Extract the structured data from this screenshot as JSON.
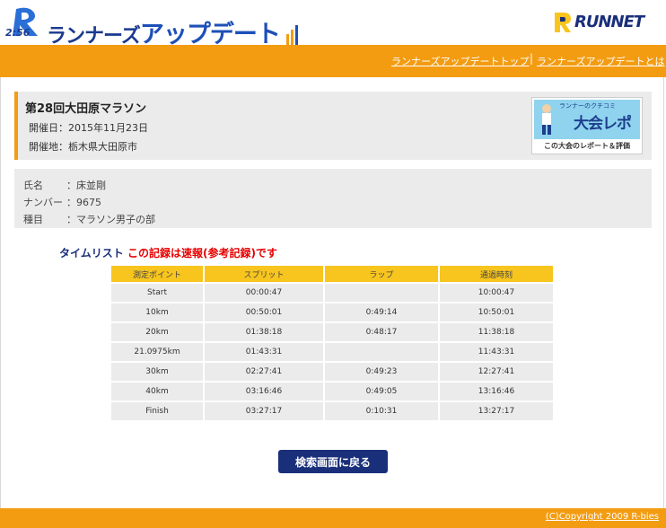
{
  "header": {
    "logo_prefix": "2:56",
    "logo_text_a": "ランナーズ",
    "logo_text_b": "アップデート",
    "partner_logo": "RUNNET"
  },
  "nav": {
    "links": [
      "ランナーズアップデートトップ",
      "ランナーズアップデートとは"
    ],
    "separator": "|"
  },
  "event": {
    "title": "第28回大田原マラソン",
    "date_label": "開催日：2015年11月23日",
    "venue_label": "開催地：栃木県大田原市",
    "banner": {
      "small": "ランナーのクチコミ",
      "big": "大会レポ",
      "foot": "この大会のレポート＆評価"
    }
  },
  "runner": {
    "rows": [
      {
        "label": "氏名",
        "value": "：床並剛"
      },
      {
        "label": "ナンバー",
        "value": "：9675"
      },
      {
        "label": "種目",
        "value": "：マラソン男子の部"
      }
    ]
  },
  "timelist": {
    "heading_a": "タイムリスト",
    "heading_b": "この記録は速報(参考記録)です",
    "columns": [
      "測定ポイント",
      "スプリット",
      "ラップ",
      "通過時刻"
    ],
    "rows": [
      [
        "Start",
        "00:00:47",
        "",
        "10:00:47"
      ],
      [
        "10km",
        "00:50:01",
        "0:49:14",
        "10:50:01"
      ],
      [
        "20km",
        "01:38:18",
        "0:48:17",
        "11:38:18"
      ],
      [
        "21.0975km",
        "01:43:31",
        "",
        "11:43:31"
      ],
      [
        "30km",
        "02:27:41",
        "0:49:23",
        "12:27:41"
      ],
      [
        "40km",
        "03:16:46",
        "0:49:05",
        "13:16:46"
      ],
      [
        "Finish",
        "03:27:17",
        "0:10:31",
        "13:27:17"
      ]
    ]
  },
  "back_button": "検索画面に戻る",
  "footer": {
    "copyright": "(C)Copyright 2009 R-bies"
  },
  "colors": {
    "orange": "#f39c12",
    "navy": "#1a2f7a",
    "yellow": "#f7c51e",
    "red": "#e60000"
  }
}
